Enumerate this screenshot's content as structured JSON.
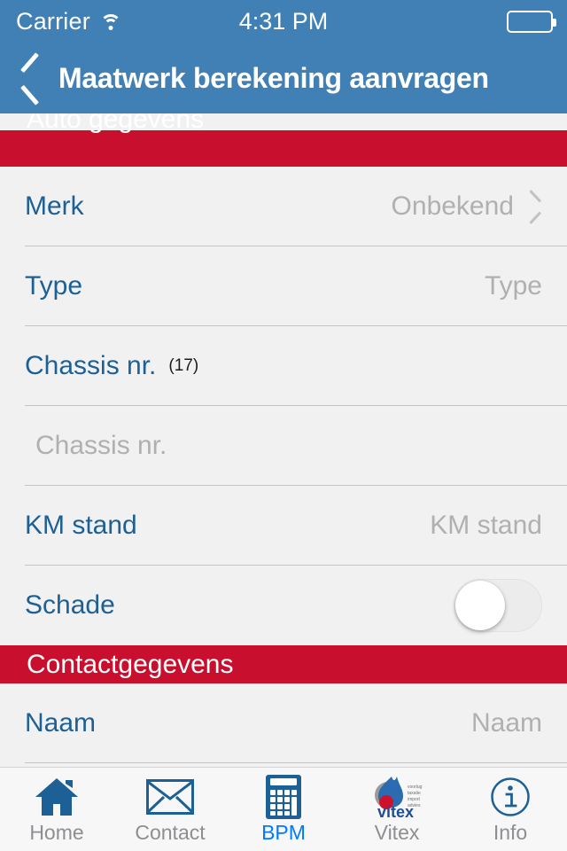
{
  "status_bar": {
    "carrier": "Carrier",
    "time": "4:31 PM",
    "wifi_icon": "wifi-icon",
    "battery_icon": "battery-icon"
  },
  "nav": {
    "title": "Maatwerk berekening aanvragen",
    "back_icon": "chevron-left-icon"
  },
  "sections": [
    {
      "title": "Auto gegevens"
    },
    {
      "title": "Contactgegevens"
    }
  ],
  "rows": {
    "merk": {
      "label": "Merk",
      "value": "Onbekend",
      "chevron": "chevron-right-icon"
    },
    "type": {
      "label": "Type",
      "placeholder": "Type"
    },
    "chassis": {
      "label": "Chassis nr.",
      "count": "(17)",
      "placeholder": "Chassis nr."
    },
    "km": {
      "label": "KM stand",
      "placeholder": "KM stand"
    },
    "schade": {
      "label": "Schade",
      "toggle_state": "off"
    },
    "naam": {
      "label": "Naam",
      "placeholder": "Naam"
    }
  },
  "tabs": [
    {
      "label": "Home",
      "icon": "home-icon",
      "active": false
    },
    {
      "label": "Contact",
      "icon": "envelope-icon",
      "active": false
    },
    {
      "label": "BPM",
      "icon": "calculator-icon",
      "active": true
    },
    {
      "label": "Vitex",
      "icon": "vitex-logo-icon",
      "active": false
    },
    {
      "label": "Info",
      "icon": "info-icon",
      "active": false
    }
  ],
  "vitex_logo": {
    "tagline_lines": [
      "voorlug",
      "taxatie",
      "import",
      "advies"
    ],
    "wordmark": "vitex"
  },
  "colors": {
    "nav_blue": "#4080b4",
    "section_red": "#c8102e",
    "label_blue": "#1d6096",
    "placeholder_gray": "#b0b0b0",
    "tab_active_blue": "#007aff",
    "tab_inactive_gray": "#8e8e93",
    "page_bg": "#f1f1f1"
  }
}
